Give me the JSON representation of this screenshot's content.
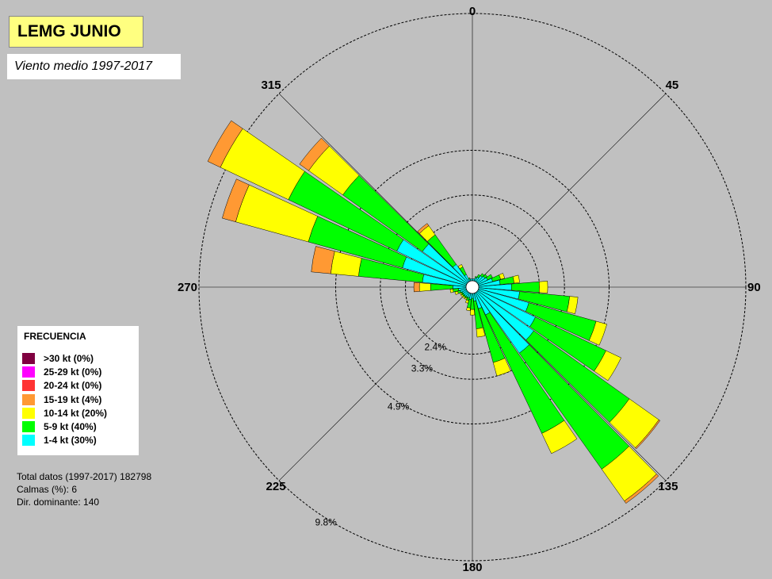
{
  "chart_data": {
    "type": "windrose",
    "station": "LEMG JUNIO",
    "subtitle": "Viento medio 1997-2017",
    "directions": [
      0,
      10,
      20,
      30,
      40,
      50,
      60,
      70,
      80,
      90,
      100,
      110,
      120,
      130,
      140,
      150,
      160,
      170,
      180,
      190,
      200,
      210,
      220,
      230,
      240,
      250,
      260,
      270,
      280,
      290,
      300,
      310,
      320,
      330,
      340,
      350
    ],
    "compass_labels": [
      {
        "angle": 0,
        "label": "0"
      },
      {
        "angle": 45,
        "label": "45"
      },
      {
        "angle": 90,
        "label": "90"
      },
      {
        "angle": 135,
        "label": "135"
      },
      {
        "angle": 180,
        "label": "180"
      },
      {
        "angle": 225,
        "label": "225"
      },
      {
        "angle": 270,
        "label": "270"
      },
      {
        "angle": 315,
        "label": "315"
      }
    ],
    "rings": [
      {
        "value": 2.4,
        "label": "2.4%"
      },
      {
        "value": 3.3,
        "label": "3.3%"
      },
      {
        "value": 4.9,
        "label": "4.9%"
      },
      {
        "value": 9.8,
        "label": "9.8%"
      }
    ],
    "r_max_percent": 9.8,
    "inner_calm_radius_percent": 0.2,
    "series": [
      {
        "name": "1-4 kt (30%)",
        "color": "#00ffff",
        "values": [
          0.1,
          0.1,
          0.15,
          0.2,
          0.3,
          0.35,
          0.4,
          0.55,
          0.8,
          1.2,
          1.5,
          1.9,
          2.3,
          2.5,
          2.7,
          0.9,
          0.6,
          0.3,
          0.2,
          0.25,
          0.2,
          0.2,
          0.2,
          0.2,
          0.2,
          0.25,
          0.3,
          0.5,
          1.6,
          2.4,
          2.8,
          2.0,
          0.8,
          0.3,
          0.1,
          0.1
        ]
      },
      {
        "name": "5-9 kt (40%)",
        "color": "#00ff00",
        "values": [
          0,
          0,
          0.05,
          0.1,
          0.1,
          0.1,
          0.2,
          0.3,
          0.5,
          1.0,
          1.8,
          2.5,
          2.8,
          4.2,
          5.1,
          4.7,
          2.0,
          1.0,
          0.4,
          0.3,
          0.1,
          0.05,
          0.05,
          0.05,
          0.05,
          0.1,
          0.2,
          0.8,
          2.3,
          3.5,
          4.3,
          3.5,
          1.3,
          0.3,
          0.05,
          0
        ]
      },
      {
        "name": "10-14 kt (20%)",
        "color": "#ffff00",
        "values": [
          0,
          0,
          0,
          0,
          0,
          0,
          0,
          0.15,
          0.2,
          0.3,
          0.3,
          0.4,
          0.6,
          1.3,
          1.4,
          0.8,
          0.5,
          0.3,
          0.2,
          0.1,
          0.1,
          0.05,
          0.05,
          0.05,
          0.05,
          0.1,
          0.1,
          0.4,
          1.0,
          2.7,
          2.7,
          1.5,
          0.4,
          0.1,
          0,
          0
        ]
      },
      {
        "name": "15-19 kt (4%)",
        "color": "#ff9933",
        "values": [
          0,
          0,
          0,
          0,
          0,
          0,
          0,
          0,
          0,
          0,
          0,
          0,
          0,
          0.05,
          0.1,
          0,
          0,
          0,
          0,
          0,
          0,
          0,
          0,
          0,
          0,
          0,
          0,
          0.2,
          0.7,
          0.5,
          0.5,
          0.4,
          0.1,
          0,
          0,
          0
        ]
      },
      {
        "name": "20-24 kt (0%)",
        "color": "#ff3333",
        "values": [
          0,
          0,
          0,
          0,
          0,
          0,
          0,
          0,
          0,
          0,
          0,
          0,
          0,
          0,
          0,
          0,
          0,
          0,
          0,
          0,
          0,
          0,
          0,
          0,
          0,
          0,
          0,
          0,
          0,
          0,
          0,
          0,
          0,
          0,
          0,
          0
        ]
      },
      {
        "name": "25-29 kt (0%)",
        "color": "#ff00ff",
        "values": [
          0,
          0,
          0,
          0,
          0,
          0,
          0,
          0,
          0,
          0,
          0,
          0,
          0,
          0,
          0,
          0,
          0,
          0,
          0,
          0,
          0,
          0,
          0,
          0,
          0,
          0,
          0,
          0,
          0,
          0,
          0,
          0,
          0,
          0,
          0,
          0
        ]
      },
      {
        "name": ">30 kt (0%)",
        "color": "#800040",
        "values": [
          0,
          0,
          0,
          0,
          0,
          0,
          0,
          0,
          0,
          0,
          0,
          0,
          0,
          0,
          0,
          0,
          0,
          0,
          0,
          0,
          0,
          0,
          0,
          0,
          0,
          0,
          0,
          0,
          0,
          0,
          0,
          0,
          0,
          0,
          0,
          0
        ]
      }
    ]
  },
  "legend": {
    "title": "FRECUENCIA",
    "items": [
      {
        "label": ">30 kt (0%)",
        "color": "#800040"
      },
      {
        "label": "25-29 kt (0%)",
        "color": "#ff00ff"
      },
      {
        "label": "20-24 kt (0%)",
        "color": "#ff3333"
      },
      {
        "label": "15-19 kt (4%)",
        "color": "#ff9933"
      },
      {
        "label": "10-14 kt (20%)",
        "color": "#ffff00"
      },
      {
        "label": "5-9 kt (40%)",
        "color": "#00ff00"
      },
      {
        "label": "1-4 kt (30%)",
        "color": "#00ffff"
      }
    ]
  },
  "stats": {
    "total": "Total datos (1997-2017) 182798",
    "calmas": "Calmas (%): 6",
    "dominante": "Dir. dominante:  140"
  }
}
